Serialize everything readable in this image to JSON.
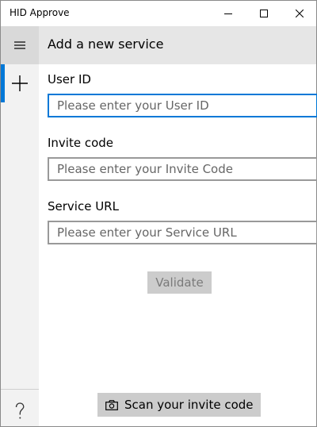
{
  "window": {
    "title": "HID Approve"
  },
  "header": {
    "title": "Add a new service"
  },
  "form": {
    "user_id": {
      "label": "User ID",
      "placeholder": "Please enter your User ID",
      "value": ""
    },
    "invite_code": {
      "label": "Invite code",
      "placeholder": "Please enter your Invite Code",
      "value": ""
    },
    "service_url": {
      "label": "Service URL",
      "placeholder": "Please enter your Service URL",
      "value": ""
    },
    "validate_label": "Validate"
  },
  "scan": {
    "label": "Scan your invite code"
  },
  "colors": {
    "accent": "#0078d7",
    "rail_bg": "#f2f2f2",
    "header_bg": "#e6e6e6",
    "button_bg": "#cccccc"
  },
  "icons": {
    "minimize": "minimize-icon",
    "maximize": "maximize-icon",
    "close": "close-icon",
    "menu": "hamburger-icon",
    "add": "plus-icon",
    "help": "question-mark-icon",
    "camera": "camera-icon"
  }
}
